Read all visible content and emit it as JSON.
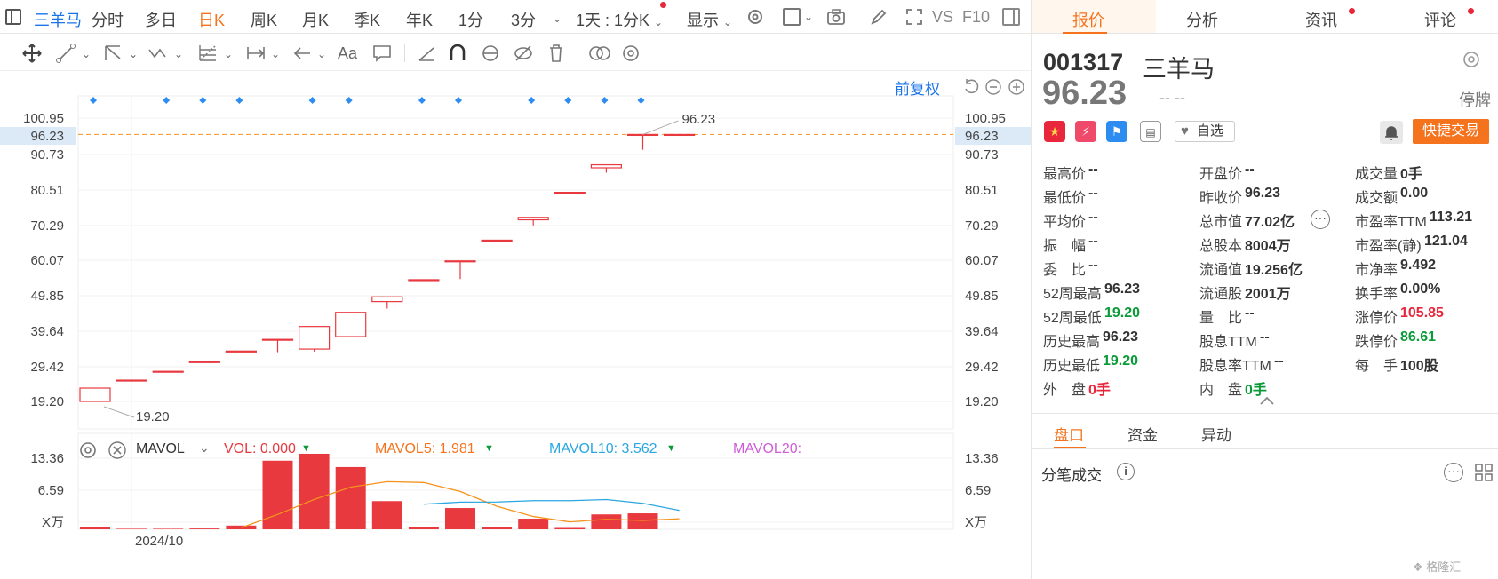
{
  "toolbar": {
    "items": [
      "三羊马",
      "分时",
      "多日",
      "日K",
      "周K",
      "月K",
      "季K",
      "年K",
      "1分",
      "3分"
    ],
    "period_select": "1天 : 1分K",
    "display_label": "显示",
    "vs_label": "VS",
    "f10_label": "F10"
  },
  "chart": {
    "adjust_label": "前复权",
    "y_ticks": [
      "100.95",
      "96.23",
      "90.73",
      "80.51",
      "70.29",
      "60.07",
      "49.85",
      "39.64",
      "29.42",
      "19.20"
    ],
    "last_price_label": "96.23",
    "low_label": "19.20",
    "high_label": "96.23",
    "date_partial": "2024/10"
  },
  "chart_data": {
    "type": "candlestick",
    "y_range": [
      19.2,
      100.95
    ],
    "candles": [
      {
        "open": 19.2,
        "close": 23.04,
        "high": 23.04,
        "low": 19.2
      },
      {
        "open": 25.34,
        "close": 25.34,
        "high": 25.34,
        "low": 25.34
      },
      {
        "open": 27.87,
        "close": 27.87,
        "high": 27.87,
        "low": 27.87
      },
      {
        "open": 30.66,
        "close": 30.66,
        "high": 30.66,
        "low": 30.66
      },
      {
        "open": 33.73,
        "close": 33.73,
        "high": 33.73,
        "low": 33.73
      },
      {
        "open": 37.1,
        "close": 37.1,
        "high": 37.1,
        "low": 33.4
      },
      {
        "open": 34.3,
        "close": 40.81,
        "high": 40.81,
        "low": 33.6
      },
      {
        "open": 37.9,
        "close": 44.89,
        "high": 44.89,
        "low": 37.9
      },
      {
        "open": 48.0,
        "close": 49.38,
        "high": 49.38,
        "low": 46.0
      },
      {
        "open": 54.32,
        "close": 54.32,
        "high": 54.32,
        "low": 54.32
      },
      {
        "open": 59.75,
        "close": 59.75,
        "high": 59.75,
        "low": 54.5
      },
      {
        "open": 65.73,
        "close": 65.73,
        "high": 65.73,
        "low": 65.73
      },
      {
        "open": 71.6,
        "close": 72.3,
        "high": 72.3,
        "low": 70.0
      },
      {
        "open": 79.53,
        "close": 79.53,
        "high": 79.53,
        "low": 79.53
      },
      {
        "open": 86.6,
        "close": 87.48,
        "high": 87.48,
        "low": 85.2
      },
      {
        "open": 96.23,
        "close": 96.23,
        "high": 96.23,
        "low": 91.8
      },
      {
        "open": 96.23,
        "close": 96.23,
        "high": 96.23,
        "low": 96.23
      }
    ]
  },
  "volume": {
    "indicator_name": "MAVOL",
    "vol_label": "VOL: 0.000",
    "mavol5_label": "MAVOL5: 1.981",
    "mavol10_label": "MAVOL10: 3.562",
    "mavol20_label": "MAVOL20:",
    "y_ticks": [
      "13.36",
      "6.59",
      "X万"
    ],
    "values": [
      0.45,
      0.1,
      0.1,
      0.15,
      0.7,
      12.9,
      14.2,
      11.7,
      5.3,
      0.4,
      4.0,
      0.35,
      2.0,
      0.25,
      2.8,
      3.0,
      0
    ],
    "mavol5": [
      null,
      null,
      null,
      null,
      0.3,
      2.79,
      5.61,
      7.93,
      8.96,
      8.8,
      7.12,
      4.35,
      2.41,
      1.4,
      1.88,
      1.68,
      1.98
    ],
    "mavol10": [
      null,
      null,
      null,
      null,
      null,
      null,
      null,
      null,
      null,
      4.72,
      5.11,
      5.13,
      5.38,
      5.39,
      5.6,
      4.89,
      3.56
    ],
    "colors": {
      "up": "#e8393f",
      "mavol5": "#f5931d",
      "mavol10": "#2aa7e0",
      "mavol20": "#d15cd8",
      "mavol_text": "#f5731d"
    }
  },
  "right_panel": {
    "tabs": [
      "报价",
      "分析",
      "资讯",
      "评论"
    ],
    "code": "001317",
    "name": "三羊马",
    "price": "96.23",
    "change": "-- --",
    "status": "停牌",
    "watch_label": "自选",
    "quick_trade": "快捷交易",
    "quotes": [
      [
        {
          "k": "最高价",
          "v": "--",
          "c": ""
        },
        {
          "k": "开盘价",
          "v": "--",
          "c": ""
        },
        {
          "k": "成交量",
          "v": "0手",
          "c": ""
        }
      ],
      [
        {
          "k": "最低价",
          "v": "--",
          "c": ""
        },
        {
          "k": "昨收价",
          "v": "96.23",
          "c": ""
        },
        {
          "k": "成交额",
          "v": "0.00",
          "c": ""
        }
      ],
      [
        {
          "k": "平均价",
          "v": "--",
          "c": ""
        },
        {
          "k": "总市值",
          "v": "77.02亿",
          "c": ""
        },
        {
          "k": "市盈率TTM",
          "v": "113.21",
          "c": ""
        }
      ],
      [
        {
          "k": "振　幅",
          "v": "--",
          "c": ""
        },
        {
          "k": "总股本",
          "v": "8004万",
          "c": ""
        },
        {
          "k": "市盈率(静)",
          "v": "121.04",
          "c": ""
        }
      ],
      [
        {
          "k": "委　比",
          "v": "--",
          "c": ""
        },
        {
          "k": "流通值",
          "v": "19.256亿",
          "c": ""
        },
        {
          "k": "市净率",
          "v": "9.492",
          "c": ""
        }
      ],
      [
        {
          "k": "52周最高",
          "v": "96.23",
          "c": ""
        },
        {
          "k": "流通股",
          "v": "2001万",
          "c": ""
        },
        {
          "k": "换手率",
          "v": "0.00%",
          "c": ""
        }
      ],
      [
        {
          "k": "52周最低",
          "v": "19.20",
          "c": "green"
        },
        {
          "k": "量　比",
          "v": "--",
          "c": ""
        },
        {
          "k": "涨停价",
          "v": "105.85",
          "c": "red"
        }
      ],
      [
        {
          "k": "历史最高",
          "v": "96.23",
          "c": ""
        },
        {
          "k": "股息TTM",
          "v": "--",
          "c": ""
        },
        {
          "k": "跌停价",
          "v": "86.61",
          "c": "green"
        }
      ],
      [
        {
          "k": "历史最低",
          "v": "19.20",
          "c": "green"
        },
        {
          "k": "股息率TTM",
          "v": "--",
          "c": ""
        },
        {
          "k": "每　手",
          "v": "100股",
          "c": ""
        }
      ],
      [
        {
          "k": "外　盘",
          "v": "0手",
          "c": "red"
        },
        {
          "k": "内　盘",
          "v": "0手",
          "c": "green"
        },
        null
      ]
    ],
    "subtabs": [
      "盘口",
      "资金",
      "异动"
    ],
    "trades_title": "分笔成交"
  },
  "watermark": "格隆汇"
}
